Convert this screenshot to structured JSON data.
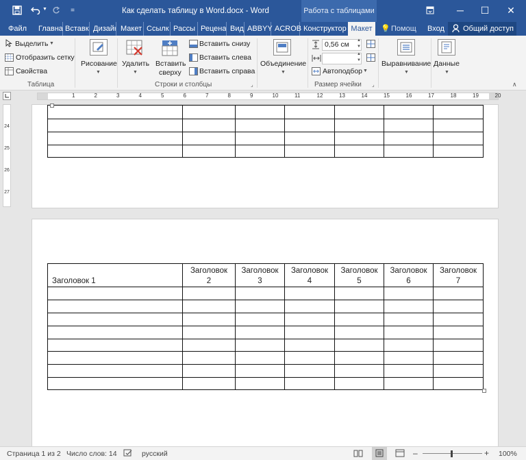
{
  "window": {
    "title": "Как сделать таблицу в Word.docx - Word",
    "context_group": "Работа с таблицами",
    "restore_icon": "ribbon-display-icon",
    "minimize": "─",
    "maximize": "☐",
    "close": "✕"
  },
  "quick_access": {
    "save_icon": "save-icon",
    "undo_icon": "undo-icon",
    "redo_icon": "redo-icon",
    "customize": "="
  },
  "tabs": [
    {
      "label": "Файл"
    },
    {
      "label": "Главна"
    },
    {
      "label": "Вставк"
    },
    {
      "label": "Дизайн"
    },
    {
      "label": "Макет"
    },
    {
      "label": "Ссылк"
    },
    {
      "label": "Рассы"
    },
    {
      "label": "Рецена"
    },
    {
      "label": "Вид"
    },
    {
      "label": "ABBYY"
    },
    {
      "label": "ACROB"
    },
    {
      "label": "Конструктор"
    },
    {
      "label": "Макет"
    }
  ],
  "tellme": "Помощ",
  "signin": "Вход",
  "share": "Общий доступ",
  "ribbon": {
    "table_group": {
      "select": "Выделить",
      "gridlines": "Отобразить сетку",
      "properties": "Свойства",
      "name": "Таблица"
    },
    "draw": "Рисование",
    "delete": "Удалить",
    "insert_above_1": "Вставить",
    "insert_above_2": "сверху",
    "insert_below": "Вставить снизу",
    "insert_left": "Вставить слева",
    "insert_right": "Вставить справа",
    "rows_cols": "Строки и столбцы",
    "merge": "Объединение",
    "height_value": "0,56 см",
    "autofit": "Автоподбор",
    "cell_size": "Размер ячейки",
    "alignment": "Выравнивание",
    "data": "Данные"
  },
  "ruler": {
    "h_marks": [
      "1",
      "2",
      "3",
      "4",
      "5",
      "6",
      "7",
      "8",
      "9",
      "10",
      "11",
      "12",
      "13",
      "14",
      "15",
      "16",
      "17",
      "18",
      "19",
      "20"
    ],
    "v_marks": [
      "24",
      "25",
      "26",
      "27"
    ]
  },
  "table_headers": [
    "Заголовок 1",
    "Заголовок 2",
    "Заголовок 3",
    "Заголовок 4",
    "Заголовок 5",
    "Заголовок 6",
    "Заголовок 7"
  ],
  "status": {
    "page": "Страница 1 из 2",
    "words": "Число слов: 14",
    "language": "русский",
    "zoom": "100%"
  }
}
